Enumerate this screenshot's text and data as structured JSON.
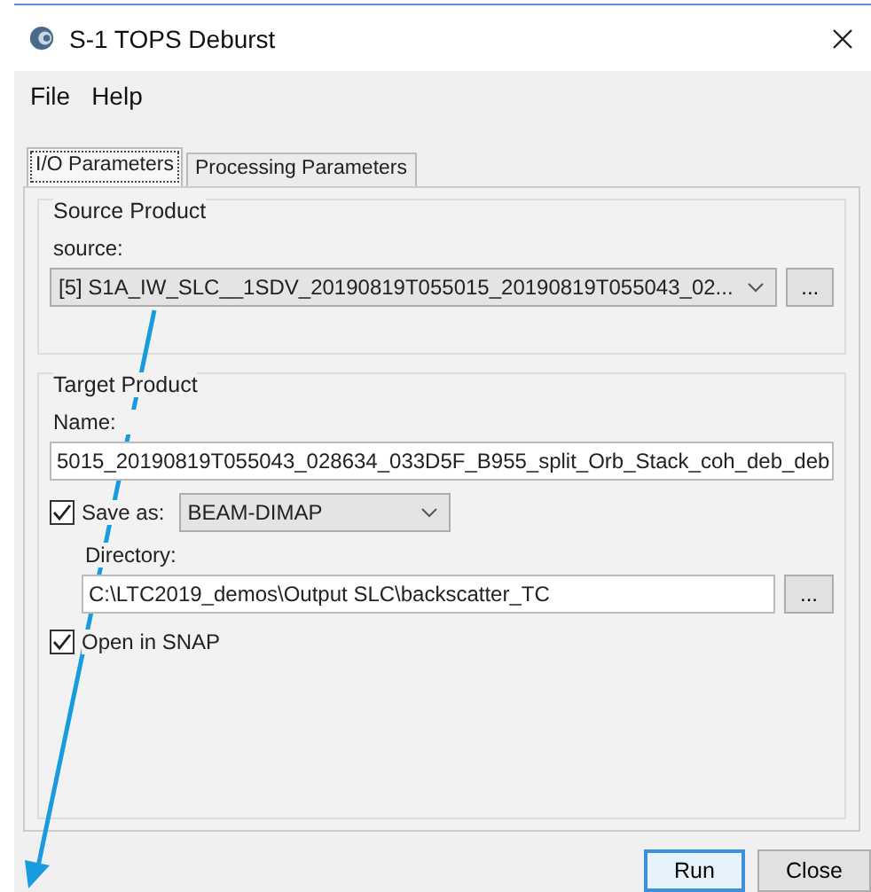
{
  "window": {
    "title": "S-1 TOPS Deburst"
  },
  "menu": [
    "File",
    "Help"
  ],
  "tabs": [
    {
      "label": "I/O Parameters",
      "selected": true
    },
    {
      "label": "Processing Parameters",
      "selected": false
    }
  ],
  "source_product": {
    "title": "Source Product",
    "label": "source:",
    "value": "[5] S1A_IW_SLC__1SDV_20190819T055015_20190819T055043_02...",
    "browse": "..."
  },
  "target_product": {
    "title": "Target Product",
    "name_label": "Name:",
    "name_value": "5015_20190819T055043_028634_033D5F_B955_split_Orb_Stack_coh_deb_deb",
    "save_as": {
      "label": "Save as:",
      "checked": true,
      "format": "BEAM-DIMAP"
    },
    "directory_label": "Directory:",
    "directory_value": "C:\\LTC2019_demos\\Output SLC\\backscatter_TC",
    "browse": "...",
    "open_in_snap": {
      "label": "Open in SNAP",
      "checked": true
    }
  },
  "buttons": [
    {
      "label": "Run",
      "default": true
    },
    {
      "label": "Close",
      "default": false
    }
  ]
}
